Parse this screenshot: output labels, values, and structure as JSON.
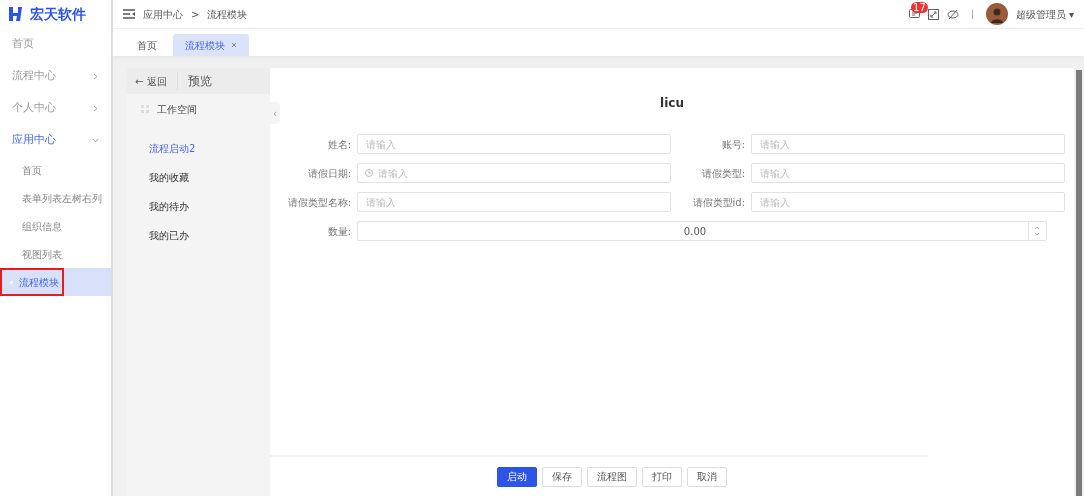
{
  "logo": {
    "text": "宏天软件"
  },
  "sidebar": {
    "items": [
      {
        "label": "首页",
        "kind": "link",
        "selected": false
      },
      {
        "label": "流程中心",
        "kind": "group",
        "expanded": false,
        "selected": false
      },
      {
        "label": "个人中心",
        "kind": "group",
        "expanded": false,
        "selected": false
      },
      {
        "label": "应用中心",
        "kind": "group",
        "expanded": true,
        "selected": false,
        "children": [
          {
            "label": "首页",
            "selected": false
          },
          {
            "label": "表单列表左树右列",
            "selected": false
          },
          {
            "label": "组织信息",
            "selected": false
          },
          {
            "label": "视图列表",
            "selected": false
          },
          {
            "label": "流程模块",
            "selected": true
          }
        ]
      }
    ]
  },
  "breadcrumb": [
    "应用中心",
    "流程模块"
  ],
  "breadcrumb_separator": ">",
  "header": {
    "notification_count": "17",
    "user": "超级管理员",
    "user_caret": "▾"
  },
  "tabs": [
    {
      "label": "首页",
      "selected": false,
      "closable": false
    },
    {
      "label": "流程模块",
      "selected": true,
      "closable": true
    }
  ],
  "panel": {
    "collapse": "‹",
    "back": "← 返回",
    "title": "预览",
    "workspace": "工作空间",
    "items": [
      {
        "label": "流程启动2",
        "selected": true
      },
      {
        "label": "我的收藏",
        "selected": false
      },
      {
        "label": "我的待办",
        "selected": false
      },
      {
        "label": "我的已办",
        "selected": false
      }
    ]
  },
  "form": {
    "title": "licu",
    "fields": [
      {
        "label": "姓名:",
        "kind": "text",
        "placeholder": "请输入"
      },
      {
        "label": "账号:",
        "kind": "text",
        "placeholder": "请输入"
      },
      {
        "label": "请假日期:",
        "kind": "date",
        "placeholder": "请输入"
      },
      {
        "label": "请假类型:",
        "kind": "text",
        "placeholder": "请输入"
      },
      {
        "label": "请假类型名称:",
        "kind": "text",
        "placeholder": "请输入"
      },
      {
        "label": "请假类型id:",
        "kind": "text",
        "placeholder": "请输入"
      },
      {
        "label": "数量:",
        "kind": "number",
        "value": "0.00"
      }
    ]
  },
  "buttons": [
    {
      "label": "启动",
      "primary": true
    },
    {
      "label": "保存",
      "primary": false
    },
    {
      "label": "流程图",
      "primary": false
    },
    {
      "label": "打印",
      "primary": false
    },
    {
      "label": "取消",
      "primary": false
    }
  ]
}
